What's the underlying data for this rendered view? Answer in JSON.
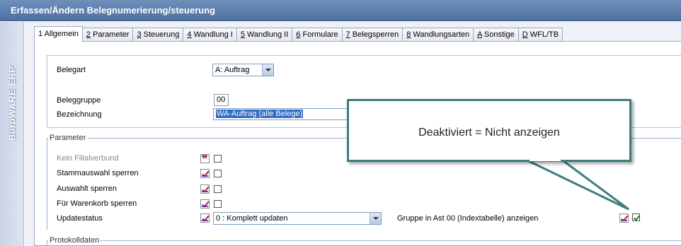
{
  "window": {
    "title": "Erfassen/Ändern Belegnumerierung/steuerung"
  },
  "sidebar": {
    "brand": "BüroWARE ERP"
  },
  "tabs": [
    {
      "key": "1",
      "label": " Allgemein"
    },
    {
      "key": "2",
      "label": " Parameter"
    },
    {
      "key": "3",
      "label": " Steuerung"
    },
    {
      "key": "4",
      "label": " Wandlung I"
    },
    {
      "key": "5",
      "label": " Wandlung II"
    },
    {
      "key": "6",
      "label": " Formulare"
    },
    {
      "key": "7",
      "label": " Belegsperren"
    },
    {
      "key": "8",
      "label": " Wandlungsarten"
    },
    {
      "key": "A",
      "label": " Sonstige"
    },
    {
      "key": "D",
      "label": " WFL/TB"
    }
  ],
  "form": {
    "belegart": {
      "label": "Belegart",
      "value": "A: Auftrag"
    },
    "beleggruppe": {
      "label": "Beleggruppe",
      "value": "00"
    },
    "bezeichnung": {
      "label": "Bezeichnung",
      "value": "WA-Auftrag (alle Belege)"
    }
  },
  "parameter": {
    "legend": "Parameter",
    "rows": [
      {
        "label": "Kein Filialverbund",
        "icon": "red-x-icon",
        "checked": false,
        "disabled": true
      },
      {
        "label": "Stammauswahl sperren",
        "icon": "red-check-icon",
        "checked": false
      },
      {
        "label": "Auswahlt sperren",
        "icon": "red-check-icon",
        "checked": false
      },
      {
        "label": "Für Warenkorb sperren",
        "icon": "red-check-icon",
        "checked": false
      }
    ],
    "updatestatus": {
      "label": "Updatestatus",
      "value": "0 : Komplett updaten"
    },
    "gruppe_ast": {
      "label": "Gruppe in Ast 00 (Indextabelle) anzeigen",
      "checked": true
    }
  },
  "protokoll": {
    "legend": "Protokolldaten"
  },
  "callout": {
    "text": "Deaktiviert = Nicht anzeigen"
  }
}
